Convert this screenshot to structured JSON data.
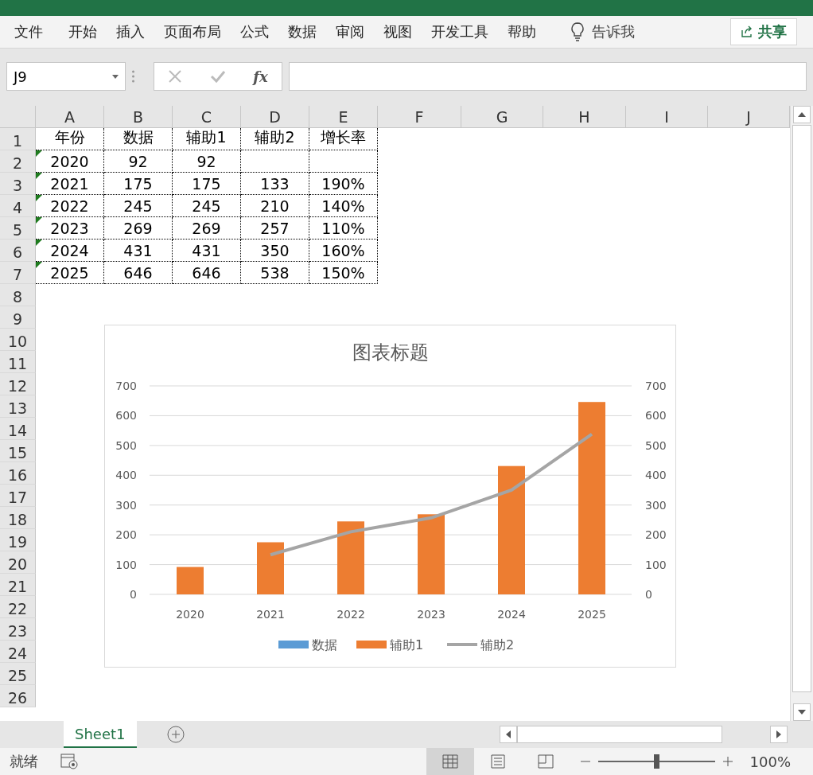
{
  "ribbon": {
    "tabs": [
      {
        "label": "文件"
      },
      {
        "label": "开始"
      },
      {
        "label": "插入"
      },
      {
        "label": "页面布局"
      },
      {
        "label": "公式"
      },
      {
        "label": "数据"
      },
      {
        "label": "审阅"
      },
      {
        "label": "视图"
      },
      {
        "label": "开发工具"
      },
      {
        "label": "帮助"
      }
    ],
    "tell_me": "告诉我",
    "share": "共享"
  },
  "formula_bar": {
    "name_box": "J9",
    "fx": "fx"
  },
  "sheet": {
    "columns": [
      "A",
      "B",
      "C",
      "D",
      "E",
      "F",
      "G",
      "H",
      "I",
      "J"
    ],
    "rows": [
      {
        "number": "1",
        "flagged": false,
        "cells": [
          "年份",
          "数据",
          "辅助1",
          "辅助2",
          "增长率"
        ]
      },
      {
        "number": "2",
        "flagged": true,
        "cells": [
          "2020",
          "92",
          "92",
          "",
          ""
        ]
      },
      {
        "number": "3",
        "flagged": true,
        "cells": [
          "2021",
          "175",
          "175",
          "133",
          "190%"
        ]
      },
      {
        "number": "4",
        "flagged": true,
        "cells": [
          "2022",
          "245",
          "245",
          "210",
          "140%"
        ]
      },
      {
        "number": "5",
        "flagged": true,
        "cells": [
          "2023",
          "269",
          "269",
          "257",
          "110%"
        ]
      },
      {
        "number": "6",
        "flagged": true,
        "cells": [
          "2024",
          "431",
          "431",
          "350",
          "160%"
        ]
      },
      {
        "number": "7",
        "flagged": true,
        "cells": [
          "2025",
          "646",
          "646",
          "538",
          "150%"
        ]
      },
      {
        "number": "8"
      },
      {
        "number": "9"
      },
      {
        "number": "10"
      },
      {
        "number": "11"
      },
      {
        "number": "12"
      },
      {
        "number": "13"
      },
      {
        "number": "14"
      },
      {
        "number": "15"
      },
      {
        "number": "16"
      },
      {
        "number": "17"
      },
      {
        "number": "18"
      },
      {
        "number": "19"
      },
      {
        "number": "20"
      },
      {
        "number": "21"
      },
      {
        "number": "22"
      },
      {
        "number": "23"
      },
      {
        "number": "24"
      },
      {
        "number": "25"
      },
      {
        "number": "26"
      }
    ],
    "chart": {
      "chart_data": {
        "type": "bar",
        "title": "图表标题",
        "categories": [
          "2020",
          "2021",
          "2022",
          "2023",
          "2024",
          "2025"
        ],
        "series": [
          {
            "name": "数据",
            "color": "#5b9bd5",
            "values": [
              null,
              null,
              null,
              null,
              null,
              null
            ]
          },
          {
            "name": "辅助1",
            "color": "#ed7d31",
            "values": [
              92,
              175,
              245,
              269,
              431,
              646
            ]
          },
          {
            "name": "辅助2",
            "color": "#a5a5a5",
            "type": "line",
            "values": [
              null,
              133,
              210,
              257,
              350,
              538
            ]
          }
        ],
        "ylim": [
          0,
          700
        ],
        "yticks": [
          0,
          100,
          200,
          300,
          400,
          500,
          600,
          700
        ],
        "grid": true,
        "legend": "bottom"
      },
      "right_axis_labels": [
        "700",
        "600",
        "500",
        "400",
        "300",
        "200",
        "100",
        "0"
      ]
    }
  },
  "sheet_tabs": [
    {
      "label": "Sheet1",
      "selected": true
    }
  ],
  "status_bar": {
    "status": "就绪",
    "views": [
      {
        "kind": "normal",
        "selected": true
      },
      {
        "kind": "page_layout",
        "selected": false
      },
      {
        "kind": "page_break",
        "selected": false
      }
    ],
    "zoom": {
      "level": 0.5,
      "reading": "100%"
    }
  }
}
